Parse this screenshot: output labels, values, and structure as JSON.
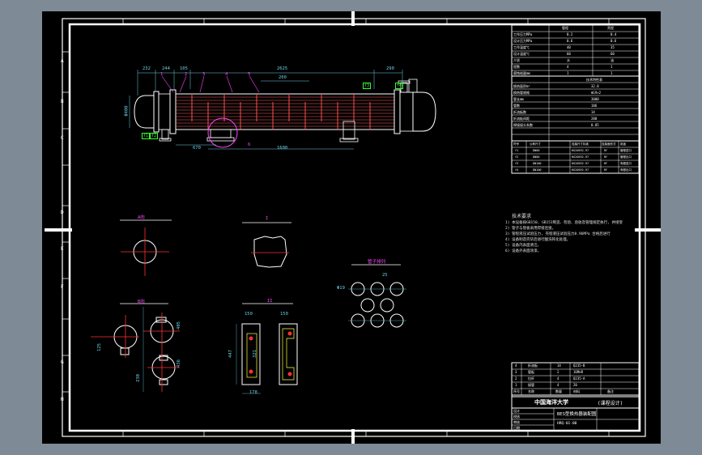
{
  "zones_left": [
    "A",
    "B",
    "C",
    "D",
    "E",
    "F",
    "G",
    "H"
  ],
  "callouts": [
    "1",
    "2",
    "3",
    "4",
    "5",
    "6"
  ],
  "dims": {
    "d232": "232",
    "d244": "244",
    "d105": "105",
    "d2625": "2625",
    "d290": "290",
    "d200": "200",
    "d1600": "1600",
    "d670": "670",
    "dH": "Φ400",
    "d25": "25",
    "d19": "Φ19",
    "d150": "150",
    "d447": "447",
    "d321": "321",
    "d178": "178",
    "d150b": "150",
    "d125": "125",
    "d405": "405",
    "d230": "230",
    "d436": "436"
  },
  "views": {
    "view_a": "A向",
    "view_b": "B向",
    "detail_1": "I",
    "detail_2": "II",
    "tube_layout": "管子排列"
  },
  "nozzles": [
    "f1",
    "f2",
    "f3",
    "f4"
  ],
  "notes": {
    "heading": "技术要求",
    "lines": [
      "1) 本设备按GB150, GB151制造、检验、验收及管理规定执行, 并接受",
      "2) 管子与管板采用焊接连接。",
      "3) 管程液压试验压力, 壳程液压试验压力0.96MPa 合格后进行",
      "4) 设备制造完毕后进行酸洗钝化处理。",
      "5) 设备内表面清洁。",
      "6) 设备外表面涂漆。"
    ]
  },
  "design_table": {
    "header": [
      "",
      "管程",
      "壳程"
    ],
    "rows": [
      [
        "工作压力MPa",
        "0.2",
        "0.4"
      ],
      [
        "设计压力MPa",
        "0.6",
        "0.6"
      ],
      [
        "工作温度℃",
        "40",
        "35"
      ],
      [
        "设计温度℃",
        "60",
        "60"
      ],
      [
        "介质",
        "水",
        "油"
      ],
      [
        "程数",
        "4",
        "1"
      ],
      [
        "腐蚀裕量mm",
        "1",
        "1"
      ]
    ],
    "section2_title": "技术特性表",
    "section2_rows": [
      [
        "换热面积m²",
        "32.8"
      ],
      [
        "换热管规格",
        "Φ19×2"
      ],
      [
        "管长mm",
        "3000"
      ],
      [
        "管数",
        "186"
      ],
      [
        "折流板数",
        "14"
      ],
      [
        "折流板间距",
        "200"
      ],
      [
        "焊接接头系数",
        "0.85"
      ]
    ],
    "nozzle_header": [
      "符号",
      "公称尺寸",
      "连接尺寸标准",
      "连接面形式",
      "用途"
    ],
    "nozzle_rows": [
      [
        "f1",
        "DN80",
        "HG20592-97",
        "RF",
        "管程进口"
      ],
      [
        "f2",
        "DN80",
        "HG20592-97",
        "RF",
        "管程出口"
      ],
      [
        "f3",
        "DN100",
        "HG20592-97",
        "RF",
        "壳程进口"
      ],
      [
        "f4",
        "DN100",
        "HG20592-97",
        "RF",
        "壳程出口"
      ]
    ]
  },
  "parts_list": {
    "rows": [
      [
        "4",
        "折流板",
        "14",
        "Q235-B",
        ""
      ],
      [
        "3",
        "管板",
        "2",
        "16MnR",
        ""
      ],
      [
        "2",
        "拉杆",
        "4",
        "Q235-A",
        ""
      ],
      [
        "1",
        "接管",
        "4",
        "20",
        ""
      ]
    ],
    "header": [
      "序号",
      "名称",
      "数量",
      "材料",
      "备注"
    ]
  },
  "title_block": {
    "school": "中国海洋大学",
    "project": "(课程设计)",
    "drawing_title": "BES型换热器装配图",
    "drawing_no": "HRQ-01-00",
    "rows": [
      "设计",
      "校核",
      "审核",
      "日期"
    ]
  }
}
